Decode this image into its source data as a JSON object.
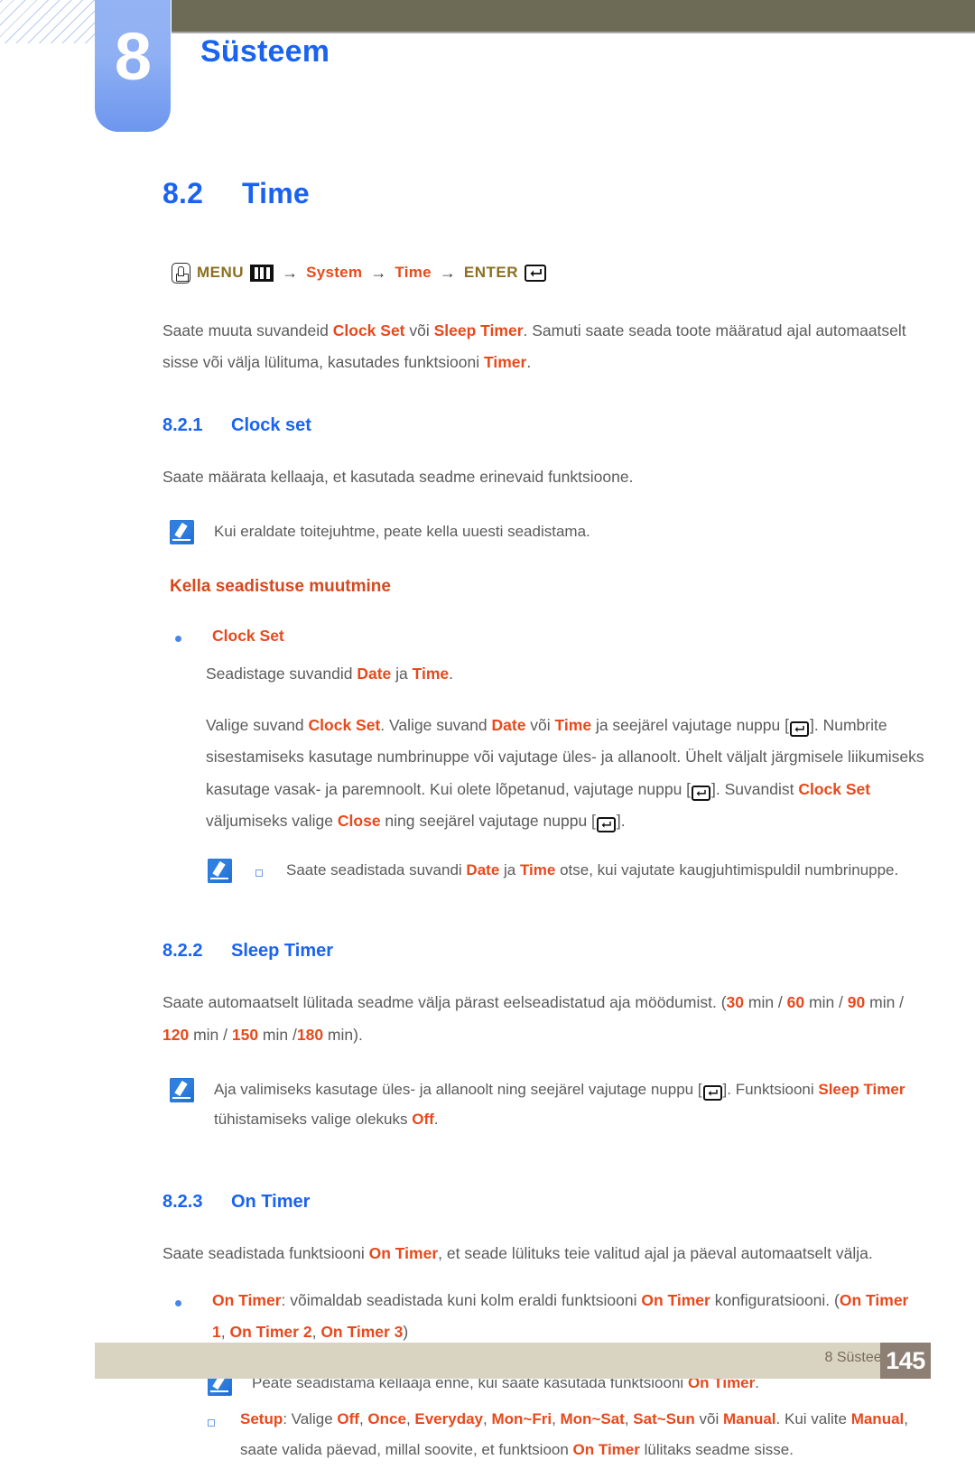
{
  "header": {
    "chapter_number": "8",
    "chapter_title": "Süsteem"
  },
  "section": {
    "number": "8.2",
    "title": "Time"
  },
  "menu_path": {
    "hand_icon": "hand-press-icon",
    "menu_label": "MENU",
    "menu_icon": "menu-bars-icon",
    "arrow1": "→",
    "item1": "System",
    "arrow2": "→",
    "item2": "Time",
    "arrow3": "→",
    "enter_label": "ENTER",
    "enter_icon": "enter-key-icon"
  },
  "intro": {
    "p1_a": "Saate muuta suvandeid ",
    "p1_hl1": "Clock Set",
    "p1_b": " või ",
    "p1_hl2": "Sleep Timer",
    "p1_c": ". Samuti saate seada toote määratud ajal automaatselt sisse või välja lülituma, kasutades funktsiooni ",
    "p1_hl3": "Timer",
    "p1_d": "."
  },
  "clock_set": {
    "number": "8.2.1",
    "title": "Clock set",
    "intro": "Saate määrata kellaaja, et kasutada seadme erinevaid funktsioone.",
    "note1": "Kui eraldate toitejuhtme, peate kella uuesti seadistama.",
    "red_heading": "Kella seadistuse muutmine",
    "bullet_label": "Clock Set",
    "bullet_line_a": "Seadistage suvandid ",
    "bullet_line_hl1": "Date",
    "bullet_line_b": " ja ",
    "bullet_line_hl2": "Time",
    "bullet_line_c": ".",
    "para_a": "Valige suvand ",
    "para_hl1": "Clock Set",
    "para_b": ". Valige suvand ",
    "para_hl2": "Date",
    "para_c": " või ",
    "para_hl3": "Time",
    "para_d": " ja seejärel vajutage nuppu [",
    "para_e": "]. Numbrite sisestamiseks kasutage numbrinuppe või vajutage üles- ja allanoolt. Ühelt väljalt järgmisele liikumiseks kasutage vasak- ja paremnoolt. Kui olete lõpetanud, vajutage nuppu [",
    "para_f": "]. Suvandist ",
    "para_hl4": "Clock Set",
    "para_g": " väljumiseks valige ",
    "para_hl5": "Close",
    "para_h": " ning seejärel vajutage nuppu [",
    "para_i": "].",
    "note2_a": "Saate seadistada suvandi ",
    "note2_hl1": "Date",
    "note2_b": " ja ",
    "note2_hl2": "Time",
    "note2_c": " otse, kui vajutate kaugjuhtimispuldil numbrinuppe."
  },
  "sleep_timer": {
    "number": "8.2.2",
    "title": "Sleep Timer",
    "para_a": "Saate automaatselt lülitada seadme välja pärast eelseadistatud aja möödumist. (",
    "v30": "30",
    "u1": " min / ",
    "v60": "60",
    "u2": " min / ",
    "v90": "90",
    "u3": " min / ",
    "v120": "120",
    "u4": " min / ",
    "v150": "150",
    "u5": " min /",
    "v180": "180",
    "u6": " min).",
    "note_a": "Aja valimiseks kasutage üles- ja allanoolt ning seejärel vajutage nuppu [",
    "note_b": "]. Funktsiooni ",
    "note_hl1": "Sleep Timer",
    "note_c": " tühistamiseks valige olekuks ",
    "note_hl2": "Off",
    "note_d": "."
  },
  "on_timer": {
    "number": "8.2.3",
    "title": "On Timer",
    "intro_a": "Saate seadistada funktsiooni ",
    "intro_hl1": "On Timer",
    "intro_b": ", et seade lülituks teie valitud ajal ja päeval automaatselt välja.",
    "bullet_hl1": "On Timer",
    "bullet_a": ": võimaldab seadistada kuni kolm eraldi funktsiooni ",
    "bullet_hl2": "On Timer",
    "bullet_b": " konfiguratsiooni. (",
    "bullet_hl3": "On Timer 1",
    "bullet_c": ", ",
    "bullet_hl4": "On Timer 2",
    "bullet_d": ", ",
    "bullet_hl5": "On Timer 3",
    "bullet_e": ")",
    "note_a": "Peate seadistama kellaaja enne, kui saate kasutada funktsiooni ",
    "note_hl1": "On Timer",
    "note_b": ".",
    "setup_hl": "Setup",
    "setup_a": ": Valige ",
    "opt_off": "Off",
    "sep1": ", ",
    "opt_once": "Once",
    "sep2": ", ",
    "opt_everyday": "Everyday",
    "sep3": ", ",
    "opt_monfri": "Mon~Fri",
    "sep4": ", ",
    "opt_monsat": "Mon~Sat",
    "sep5": ", ",
    "opt_satsun": "Sat~Sun",
    "sep6": " või ",
    "opt_manual": "Manual",
    "setup_b": ". Kui valite ",
    "opt_manual2": "Manual",
    "setup_c": ", saate valida päevad, millal soovite, et funktsioon ",
    "setup_hl2": "On Timer",
    "setup_d": " lülitaks seadme sisse."
  },
  "footer": {
    "label": "8 Süsteem",
    "page": "145"
  },
  "colors": {
    "accent_blue": "#1a63f0",
    "highlight_orange": "#e8491c",
    "olive_bar": "#6d6b56",
    "menu_olive": "#8a7020",
    "footer_bar": "#d9d3c1",
    "page_box": "#8d7f73"
  }
}
